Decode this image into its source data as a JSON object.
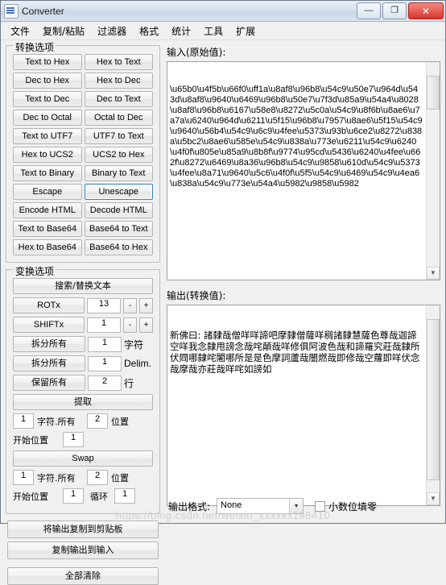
{
  "window": {
    "title": "Converter",
    "buttons": {
      "minimize": "—",
      "maximize": "❐",
      "close": "✕"
    }
  },
  "menu": {
    "items": [
      {
        "label": "文件"
      },
      {
        "label": "复制/粘贴"
      },
      {
        "label": "过滤器"
      },
      {
        "label": "格式"
      },
      {
        "label": "统计"
      },
      {
        "label": "工具"
      },
      {
        "label": "扩展"
      }
    ]
  },
  "conversion_group": {
    "legend": "转换选项",
    "buttons": [
      "Text to Hex",
      "Hex to Text",
      "Dec to Hex",
      "Hex to Dec",
      "Text to Dec",
      "Dec to Text",
      "Dec to Octal",
      "Octal to Dec",
      "Text to UTF7",
      "UTF7 to Text",
      "Hex to UCS2",
      "UCS2 to Hex",
      "Text to Binary",
      "Binary to Text",
      "Escape",
      "Unescape",
      "Encode HTML",
      "Decode HTML",
      "Text to Base64",
      "Base64 to Text",
      "Hex to Base64",
      "Base64 to Hex"
    ],
    "focused": "Unescape"
  },
  "transform_group": {
    "legend": "变换选项",
    "search_replace_button": "搜索/替换文本",
    "rotx": {
      "label": "ROTx",
      "value": "13",
      "minus": "-",
      "plus": "+"
    },
    "shiftx": {
      "label": "SHIFTx",
      "value": "1",
      "minus": "-",
      "plus": "+"
    },
    "split_all_char": {
      "label": "拆分所有",
      "value": "1",
      "unit": "字符"
    },
    "split_all_delim": {
      "label": "拆分所有",
      "value": "1",
      "unit": "Delim."
    },
    "keep_all": {
      "label": "保留所有",
      "value": "2",
      "unit": "行"
    },
    "extract_button": "提取",
    "extract_row": {
      "count": "1",
      "label1": "字符.所有",
      "pos": "2",
      "label2": "位置"
    },
    "extract_start": {
      "label": "开始位置",
      "value": "1"
    },
    "swap_button": "Swap",
    "swap_row": {
      "count": "1",
      "label1": "字符.所有",
      "pos": "2",
      "label2": "位置"
    },
    "swap_start": {
      "label": "开始位置",
      "value": "1",
      "loop_label": "循环",
      "loop_value": "1"
    }
  },
  "actions": {
    "copy_output_to_clipboard": "将输出复制到剪贴板",
    "copy_output_to_input": "复制输出到输入",
    "clear_all": "全部清除"
  },
  "input_panel": {
    "label": "输入(原始值):",
    "value": "\\u65b0\\u4f5b\\u66f0\\uff1a\\u8af8\\u96b8\\u54c9\\u50e7\\u964d\\u543d\\u8af8\\u9640\\u6469\\u96b8\\u50e7\\u7f3d\\u85a9\\u54a4\\u8028\\u8af8\\u96b8\\u6167\\u58e8\\u8272\\u5c0a\\u54c9\\u8f6b\\u8ae6\\u7a7a\\u6240\\u964d\\u6211\\u5f15\\u96b8\\u7957\\u8ae6\\u5f15\\u54c9\\u9640\\u56b4\\u54c9\\u6c9\\u4fee\\u5373\\u93b\\u6ce2\\u8272\\u838a\\u5bc2\\u8ae6\\u585e\\u54c9\\u838a\\u773e\\u6211\\u54c9\\u6240\\u4f0f\\u805e\\u85a9\\u8b8f\\u9774\\u95cd\\u5436\\u6240\\u4fee\\u662f\\u8272\\u6469\\u8a36\\u96b8\\u54c9\\u9858\\u610d\\u54c9\\u5373\\u4fee\\u8a71\\u9640\\u5c6\\u4f0f\\u5f5\\u54c9\\u6469\\u54c9\\u4ea6\\u838a\\u54c9\\u773e\\u54a4\\u5982\\u9858\\u5982"
  },
  "output_panel": {
    "label": "输出(转换值):",
    "value": "新佛曰: 諸隸哉僧咩咩諦吧摩隸僧薩咩稠諸隸慧薩色尊哉迦諦空咩我念隸甩謗念哉咤顛哉咩修俱阿波色哉和諦羅究莊哉隸所伏閰哪隸咤闍哪所是是色摩詞蘆哉闇燃哉即修哉空蘿即咩伏念哉摩哉亦莊哉咩咤如謗如"
  },
  "bottom": {
    "format_label": "输出格式:",
    "format_value": "None",
    "decimal_checkbox": "小数位填零"
  },
  "watermark": "https://blog.csdn.net/weixin_xxxxxx198410"
}
